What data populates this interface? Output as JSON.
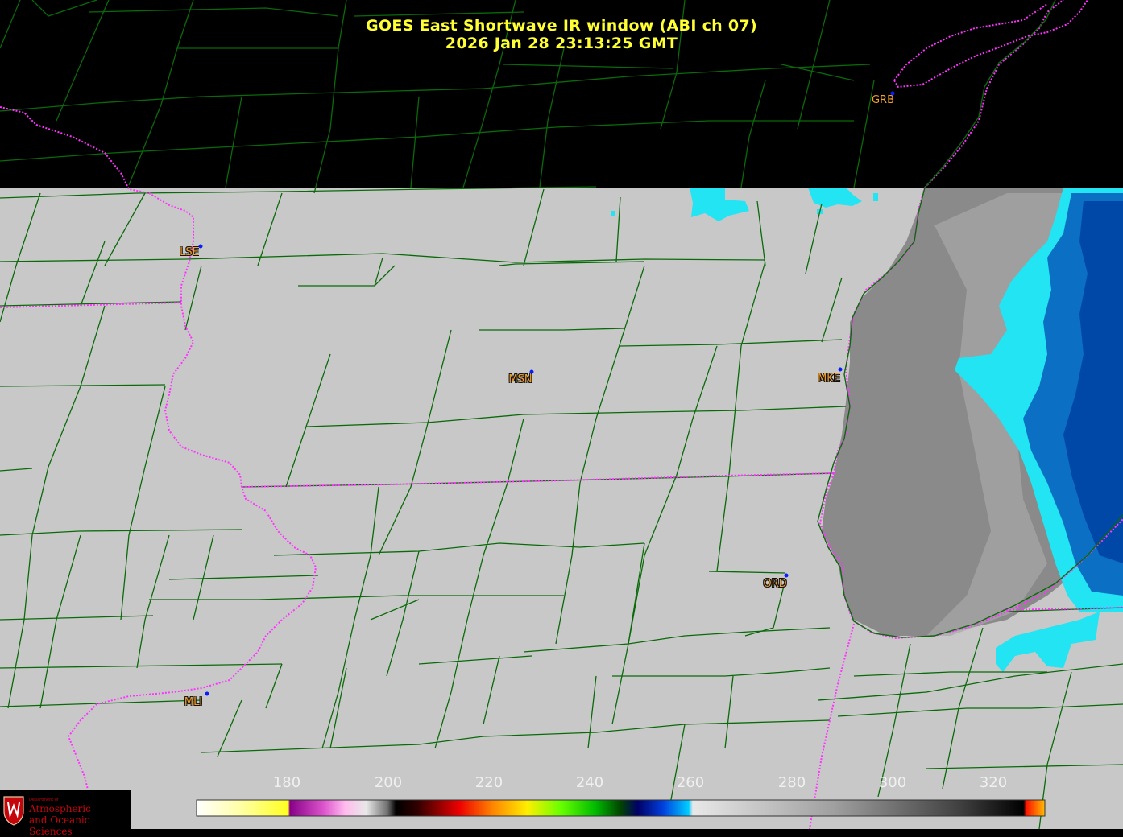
{
  "header": {
    "title_line1": "GOES East Shortwave IR window (ABI ch 07)",
    "title_line2": "2026 Jan 28  23:13:25 GMT"
  },
  "stations": [
    {
      "code": "GRB",
      "outlined": false
    },
    {
      "code": "LSE",
      "outlined": true
    },
    {
      "code": "MSN",
      "outlined": true
    },
    {
      "code": "MKE",
      "outlined": true
    },
    {
      "code": "ORD",
      "outlined": true
    },
    {
      "code": "MLI",
      "outlined": true
    }
  ],
  "colorbar": {
    "ticks": [
      "180",
      "200",
      "220",
      "240",
      "260",
      "280",
      "300",
      "320"
    ],
    "range": [
      163,
      333
    ]
  },
  "logo": {
    "dept": "Department of",
    "line1": "Atmospheric",
    "line2": "and Oceanic Sciences"
  },
  "colors": {
    "background": "#000000",
    "land": "#c8c8c8",
    "lake": "#8a8a8a",
    "county_lines": "#0a6a0a",
    "state_border": "#ff33ff",
    "title": "#ffff33",
    "station_label": "#f3a02a",
    "station_dot": "#0a1cff",
    "cloud_cyan": "#22e4f2",
    "cloud_blue": "#0050b0"
  }
}
